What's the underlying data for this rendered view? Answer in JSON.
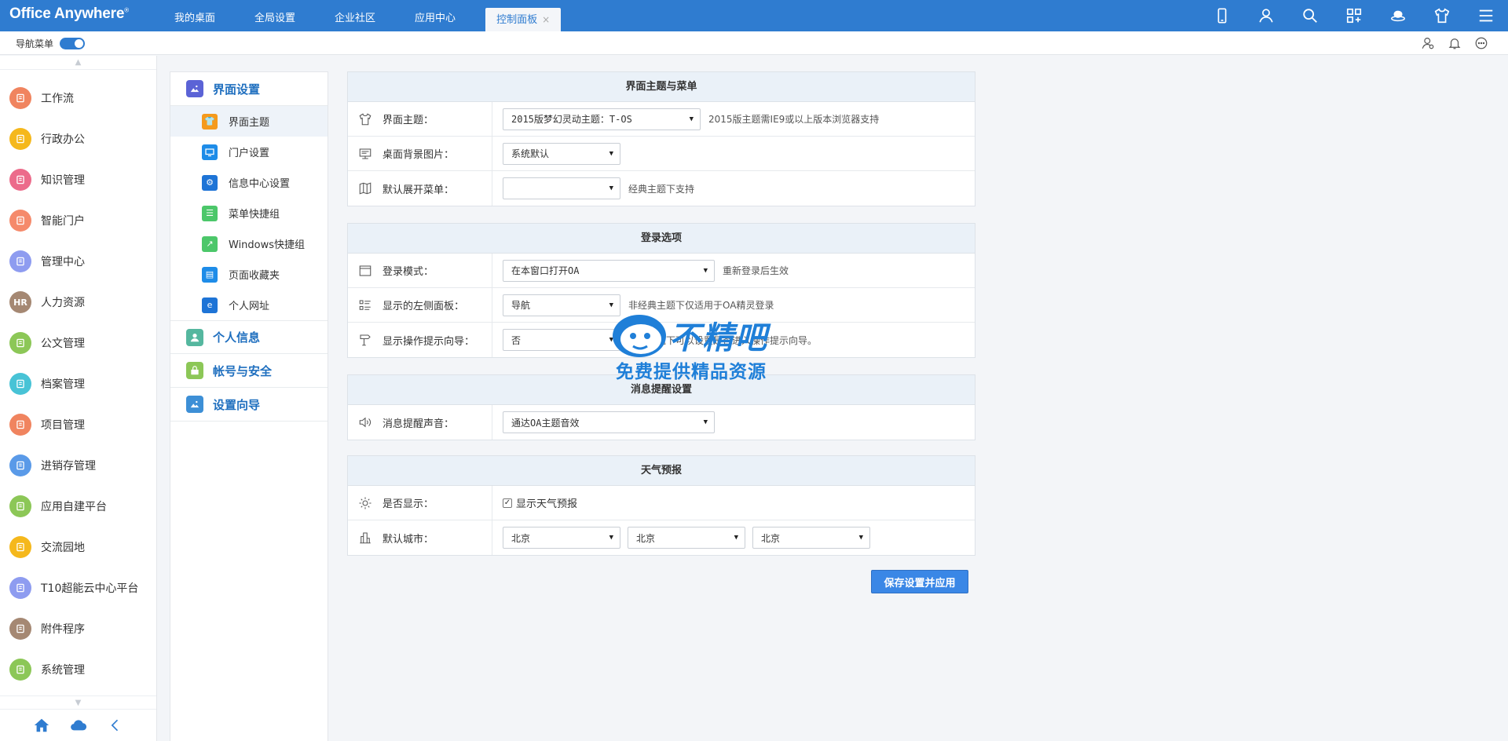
{
  "app": {
    "logo": "Office Anywhere",
    "logo_mark": "®"
  },
  "topbar": {
    "tabs": [
      {
        "label": "我的桌面"
      },
      {
        "label": "全局设置"
      },
      {
        "label": "企业社区"
      },
      {
        "label": "应用中心"
      },
      {
        "label": "控制面板",
        "active": true
      }
    ],
    "tab_close": "×",
    "icons": [
      "mobile-icon",
      "user-icon",
      "search-icon",
      "apps-icon",
      "cloud-service-icon",
      "shirt-icon",
      "menu-icon"
    ]
  },
  "subbar": {
    "nav_menu_label": "导航菜单",
    "icons": [
      "org-user-icon",
      "bell-icon",
      "chat-icon"
    ]
  },
  "sidebar": {
    "items": [
      {
        "label": "工作流",
        "color": "#f0845f",
        "icon": "workflow-icon"
      },
      {
        "label": "行政办公",
        "color": "#f5b81c",
        "icon": "admin-icon"
      },
      {
        "label": "知识管理",
        "color": "#ec6b8b",
        "icon": "book-icon"
      },
      {
        "label": "智能门户",
        "color": "#f58a6b",
        "icon": "portal-icon"
      },
      {
        "label": "管理中心",
        "color": "#8e9cf0",
        "icon": "manage-icon"
      },
      {
        "label": "人力资源",
        "color": "#a58873",
        "icon": "hr-icon",
        "glyph": "HR"
      },
      {
        "label": "公文管理",
        "color": "#8cc757",
        "icon": "briefcase-icon"
      },
      {
        "label": "档案管理",
        "color": "#48c3d6",
        "icon": "archive-icon"
      },
      {
        "label": "项目管理",
        "color": "#f0845f",
        "icon": "project-icon"
      },
      {
        "label": "进销存管理",
        "color": "#5a9ae8",
        "icon": "stock-icon"
      },
      {
        "label": "应用自建平台",
        "color": "#8cc757",
        "icon": "chart-icon"
      },
      {
        "label": "交流园地",
        "color": "#f5b81c",
        "icon": "chat-bubble-icon"
      },
      {
        "label": "T10超能云中心平台",
        "color": "#8e9cf0",
        "icon": "cloud-icon"
      },
      {
        "label": "附件程序",
        "color": "#a58873",
        "icon": "paperclip-icon"
      },
      {
        "label": "系统管理",
        "color": "#8cc757",
        "icon": "gear-icon"
      }
    ],
    "footer_icons": [
      "home-icon",
      "cloud-icon",
      "chevron-left-icon"
    ]
  },
  "subnav": {
    "sections": [
      {
        "label": "界面设置",
        "color": "#5b63d6",
        "icon": "image-icon",
        "items": [
          {
            "label": "界面主题",
            "color": "#f59a1c",
            "icon": "shirt-icon",
            "active": true
          },
          {
            "label": "门户设置",
            "color": "#1e8ce8",
            "icon": "monitor-icon"
          },
          {
            "label": "信息中心设置",
            "color": "#1e74d6",
            "icon": "gear-icon"
          },
          {
            "label": "菜单快捷组",
            "color": "#4cc76a",
            "icon": "list-icon"
          },
          {
            "label": "Windows快捷组",
            "color": "#4cc76a",
            "icon": "arrow-icon"
          },
          {
            "label": "页面收藏夹",
            "color": "#1e8ce8",
            "icon": "folder-icon"
          },
          {
            "label": "个人网址",
            "color": "#1e74d6",
            "icon": "ie-icon"
          }
        ]
      },
      {
        "label": "个人信息",
        "color": "#55b79f",
        "icon": "person-icon",
        "items": []
      },
      {
        "label": "帐号与安全",
        "color": "#8cc757",
        "icon": "lock-icon",
        "items": []
      },
      {
        "label": "设置向导",
        "color": "#3d8fd6",
        "icon": "image-icon",
        "items": []
      }
    ]
  },
  "panels": {
    "theme": {
      "title": "界面主题与菜单",
      "rows": [
        {
          "label": "界面主题：",
          "icon": "shirt-outline-icon",
          "select": "2015版梦幻灵动主题：T-OS",
          "hint": "2015版主题需IE9或以上版本浏览器支持"
        },
        {
          "label": "桌面背景图片：",
          "icon": "display-outline-icon",
          "select": "系统默认",
          "hint": ""
        },
        {
          "label": "默认展开菜单：",
          "icon": "map-outline-icon",
          "select": "",
          "hint": "经典主题下支持"
        }
      ]
    },
    "login": {
      "title": "登录选项",
      "rows": [
        {
          "label": "登录模式：",
          "icon": "window-outline-icon",
          "select": "在本窗口打开OA",
          "hint": "重新登录后生效"
        },
        {
          "label": "显示的左侧面板：",
          "icon": "list-outline-icon",
          "select": "导航",
          "hint": "非经典主题下仅适用于OA精灵登录"
        },
        {
          "label": "显示操作提示向导：",
          "icon": "signpost-outline-icon",
          "select": "否",
          "hint": "灵动主题下可以设置是否进入操作提示向导。"
        }
      ]
    },
    "message": {
      "title": "消息提醒设置",
      "rows": [
        {
          "label": "消息提醒声音：",
          "icon": "speaker-outline-icon",
          "select": "通达OA主题音效",
          "hint": ""
        }
      ]
    },
    "weather": {
      "title": "天气预报",
      "show_label": "是否显示：",
      "show_icon": "sun-outline-icon",
      "checkbox_label": "显示天气预报",
      "checked": true,
      "city_label": "默认城市：",
      "city_icon": "city-outline-icon",
      "cities": [
        "北京",
        "北京",
        "北京"
      ]
    }
  },
  "actions": {
    "save_label": "保存设置并应用"
  },
  "watermark": {
    "brand": "不精吧",
    "slogan": "免费提供精品资源"
  },
  "colors": {
    "topbar": "#2f7cd0",
    "accent": "#1f6fbf",
    "button": "#3a87e6"
  }
}
